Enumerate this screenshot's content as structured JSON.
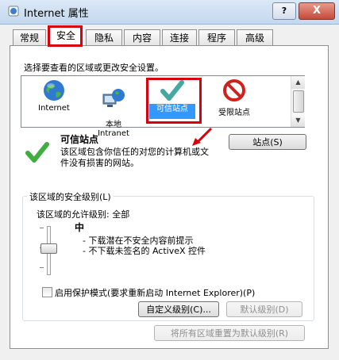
{
  "window": {
    "title": "Internet 属性",
    "help_label": "?",
    "close_label": "X"
  },
  "tabs": [
    {
      "label": "常规"
    },
    {
      "label": "安全"
    },
    {
      "label": "隐私"
    },
    {
      "label": "内容"
    },
    {
      "label": "连接"
    },
    {
      "label": "程序"
    },
    {
      "label": "高级"
    }
  ],
  "active_tab": "安全",
  "zones": {
    "instruction": "选择要查看的区域或更改安全设置。",
    "items": [
      {
        "label": "Internet",
        "icon": "globe-icon"
      },
      {
        "label": "本地\nIntranet",
        "icon": "intranet-icon"
      },
      {
        "label": "可信站点",
        "icon": "checkmark-icon"
      },
      {
        "label": "受限站点",
        "icon": "forbidden-icon"
      }
    ],
    "selected": "可信站点"
  },
  "zone_detail": {
    "title": "可信站点",
    "description": "该区域包含你信任的对您的计算机或文件没有损害的网站。",
    "sites_button": "站点(S)",
    "icon": "checkmark-icon"
  },
  "security_level": {
    "group_label": "该区域的安全级别(L)",
    "allowed_levels": "该区域的允许级别: 全部",
    "level_name": "中",
    "bullets": [
      "- 下载潜在不安全内容前提示",
      "- 不下载未签名的 ActiveX 控件"
    ],
    "slider_level": "中",
    "protected_mode_label": "启用保护模式(要求重新启动 Internet Explorer)(P)",
    "protected_mode_checked": false,
    "custom_level_button": "自定义级别(C)...",
    "default_level_button": "默认级别(D)",
    "reset_all_button": "将所有区域重置为默认级别(R)"
  },
  "colors": {
    "highlight_red": "#d8000c",
    "selection_blue": "#3399ff",
    "check_green": "#3fae3f"
  }
}
